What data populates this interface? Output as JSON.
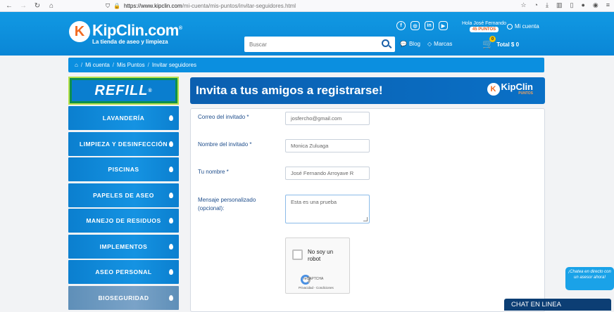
{
  "browser": {
    "url_host": "https://www.kipclin.com",
    "url_path": "/mi-cuenta/mis-puntos/invitar-seguidores.html"
  },
  "header": {
    "brand": "KipClin.com",
    "brand_mark": "®",
    "tagline": "La tienda de aseo y limpieza",
    "greeting": "Hola José Fernando",
    "points": "45 PUNTOS",
    "account_label": "Mi cuenta",
    "search_placeholder": "Buscar",
    "blog_label": "Blog",
    "brands_label": "Marcas",
    "cart_count": "0",
    "cart_total": "Total $ 0"
  },
  "breadcrumb": {
    "items": [
      "Mi cuenta",
      "Mis Puntos",
      "Invitar seguidores"
    ]
  },
  "sidebar": {
    "refill_label": "REFILL",
    "refill_mark": "®",
    "categories": [
      "LAVANDERÍA",
      "LIMPIEZA Y DESINFECCIÓN",
      "PISCINAS",
      "PAPELES DE ASEO",
      "MANEJO DE RESIDUOS",
      "IMPLEMENTOS",
      "ASEO PERSONAL",
      "BIOSEGURIDAD"
    ]
  },
  "banner": {
    "title": "Invita a tus amigos a registrarse!",
    "logo_text": "KipClin",
    "logo_sub": "PUNTOS"
  },
  "form": {
    "invitee_email_label": "Correo del invitado *",
    "invitee_email_value": "josfercho@gmail.com",
    "invitee_name_label": "Nombre del invitado *",
    "invitee_name_value": "Monica Zuluaga",
    "your_name_label": "Tu nombre *",
    "your_name_value": "José Fernando Arroyave R",
    "message_label": "Mensaje personalizado (opcional):",
    "message_value": "Esta es una prueba",
    "captcha_label": "No soy un robot",
    "captcha_brand": "reCAPTCHA",
    "captcha_legal": "Privacidad - Condiciones"
  },
  "chat": {
    "bubble_text": "¡Chatea en directo con un asesor ahora!",
    "bar_label": "CHAT EN LINEA"
  }
}
